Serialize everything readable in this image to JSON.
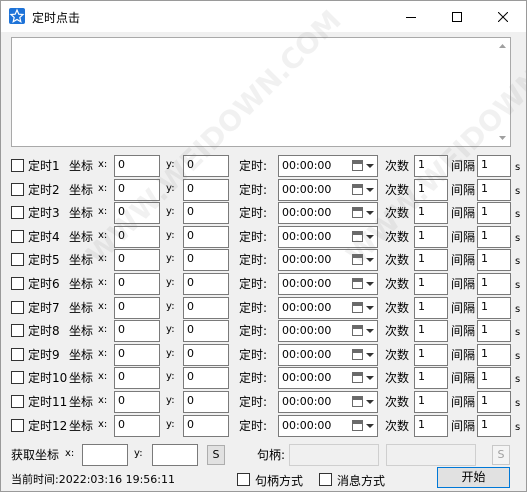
{
  "window": {
    "title": "定时点击"
  },
  "row_labels": {
    "coord": "坐标",
    "x": "x:",
    "y": "y:",
    "time": "定时:",
    "count": "次数",
    "interval": "间隔",
    "sec": "s"
  },
  "rows": [
    {
      "name": "定时1",
      "x": "0",
      "y": "0",
      "time": "00:00:00",
      "count": "1",
      "interval": "1"
    },
    {
      "name": "定时2",
      "x": "0",
      "y": "0",
      "time": "00:00:00",
      "count": "1",
      "interval": "1"
    },
    {
      "name": "定时3",
      "x": "0",
      "y": "0",
      "time": "00:00:00",
      "count": "1",
      "interval": "1"
    },
    {
      "name": "定时4",
      "x": "0",
      "y": "0",
      "time": "00:00:00",
      "count": "1",
      "interval": "1"
    },
    {
      "name": "定时5",
      "x": "0",
      "y": "0",
      "time": "00:00:00",
      "count": "1",
      "interval": "1"
    },
    {
      "name": "定时6",
      "x": "0",
      "y": "0",
      "time": "00:00:00",
      "count": "1",
      "interval": "1"
    },
    {
      "name": "定时7",
      "x": "0",
      "y": "0",
      "time": "00:00:00",
      "count": "1",
      "interval": "1"
    },
    {
      "name": "定时8",
      "x": "0",
      "y": "0",
      "time": "00:00:00",
      "count": "1",
      "interval": "1"
    },
    {
      "name": "定时9",
      "x": "0",
      "y": "0",
      "time": "00:00:00",
      "count": "1",
      "interval": "1"
    },
    {
      "name": "定时10",
      "x": "0",
      "y": "0",
      "time": "00:00:00",
      "count": "1",
      "interval": "1"
    },
    {
      "name": "定时11",
      "x": "0",
      "y": "0",
      "time": "00:00:00",
      "count": "1",
      "interval": "1"
    },
    {
      "name": "定时12",
      "x": "0",
      "y": "0",
      "time": "00:00:00",
      "count": "1",
      "interval": "1"
    }
  ],
  "get_coord": {
    "label": "获取坐标",
    "x_label": "x:",
    "y_label": "y:",
    "x": "",
    "y": "",
    "s_button": "S"
  },
  "handle": {
    "label": "句柄:",
    "value": "",
    "s_button": "S"
  },
  "status": {
    "current_time": "当前时间:2022:03:16 19:56:11"
  },
  "options": {
    "handle_mode": "句柄方式",
    "message_mode": "消息方式"
  },
  "start_button": "开始",
  "watermark": "WWW.WEIDOWN.COM"
}
